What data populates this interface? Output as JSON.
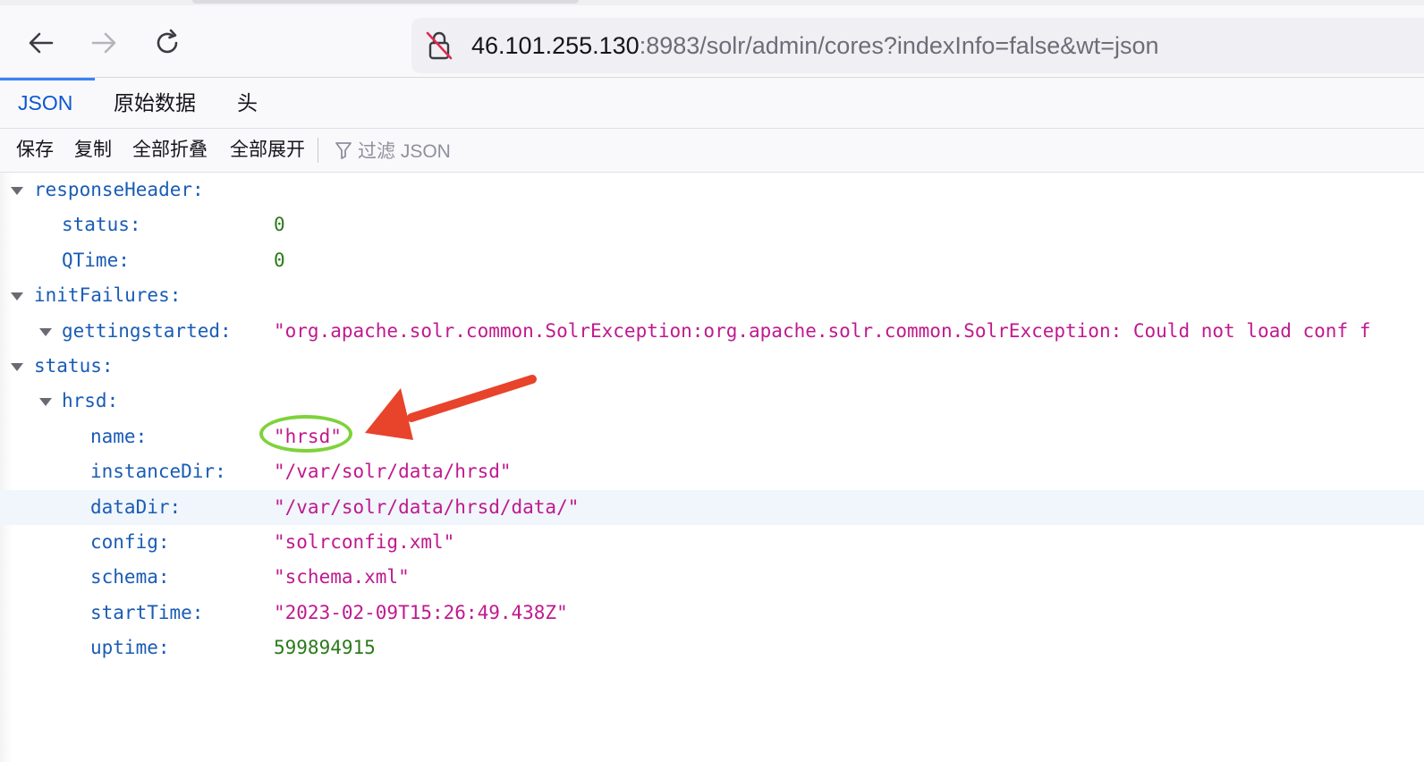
{
  "browser": {
    "url_host": "46.101.255.130",
    "url_path": ":8983/solr/admin/cores?indexInfo=false&wt=json",
    "back_icon": "arrow-left-icon",
    "forward_icon": "arrow-right-icon",
    "reload_icon": "reload-icon",
    "security_icon": "insecure-lock-icon"
  },
  "tabs": [
    {
      "label": "JSON"
    },
    {
      "label": "原始数据"
    },
    {
      "label": "头"
    }
  ],
  "json_toolbar": {
    "save": "保存",
    "copy": "复制",
    "collapse_all": "全部折叠",
    "expand_all": "全部展开",
    "filter_placeholder": "过滤 JSON"
  },
  "tree": {
    "responseHeader": {
      "key": "responseHeader:",
      "status": {
        "key": "status:",
        "value": "0"
      },
      "qtime": {
        "key": "QTime:",
        "value": "0"
      }
    },
    "initFailures": {
      "key": "initFailures:",
      "gettingstarted": {
        "key": "gettingstarted:",
        "value": "\"org.apache.solr.common.SolrException:org.apache.solr.common.SolrException: Could not load conf f"
      }
    },
    "status": {
      "key": "status:",
      "hrsd": {
        "key": "hrsd:",
        "name": {
          "key": "name:",
          "value": "\"hrsd\""
        },
        "instanceDir": {
          "key": "instanceDir:",
          "value": "\"/var/solr/data/hrsd\""
        },
        "dataDir": {
          "key": "dataDir:",
          "value": "\"/var/solr/data/hrsd/data/\""
        },
        "config": {
          "key": "config:",
          "value": "\"solrconfig.xml\""
        },
        "schema": {
          "key": "schema:",
          "value": "\"schema.xml\""
        },
        "startTime": {
          "key": "startTime:",
          "value": "\"2023-02-09T15:26:49.438Z\""
        },
        "uptime": {
          "key": "uptime:",
          "value": "599894915"
        }
      }
    }
  },
  "colors": {
    "key": "#1a5cb5",
    "string": "#c0198e",
    "number": "#2a7a1a",
    "annotation_ellipse": "#7ed23a",
    "annotation_arrow": "#e8432b"
  }
}
